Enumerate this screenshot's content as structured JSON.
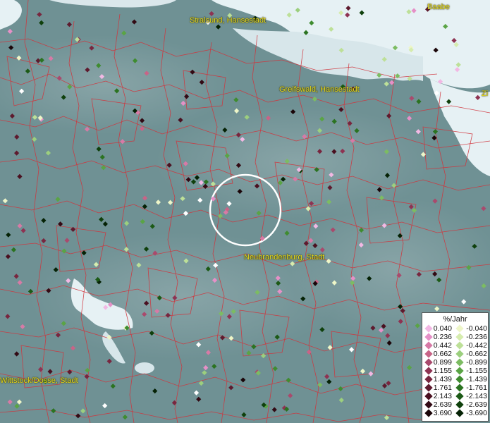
{
  "map": {
    "cities": [
      {
        "name": "Stralsund, Hansestadt"
      },
      {
        "name": "Greifswald, Hansestadt"
      },
      {
        "name": "Neubrandenburg, Stadt"
      },
      {
        "name": "Wittstock/Dosse, Stadt"
      },
      {
        "name": "Baabe"
      },
      {
        "name": "Zi"
      }
    ],
    "colors": {
      "land": "#6f9194",
      "water": "#e6f1f4",
      "boundary": "#d0343c",
      "label": "#e8dc1e",
      "circle": "#ffffff"
    }
  },
  "legend": {
    "title": "%/Jahr",
    "positive": [
      {
        "value": "0.040",
        "color": "#f2b8e4"
      },
      {
        "value": "0.236",
        "color": "#e690c7"
      },
      {
        "value": "0.442",
        "color": "#d77aa6"
      },
      {
        "value": "0.662",
        "color": "#c86487"
      },
      {
        "value": "0.899",
        "color": "#a94a6d"
      },
      {
        "value": "1.155",
        "color": "#8e3352"
      },
      {
        "value": "1.439",
        "color": "#78263f"
      },
      {
        "value": "1.761",
        "color": "#5e1a2e"
      },
      {
        "value": "2.143",
        "color": "#4a1020"
      },
      {
        "value": "2.639",
        "color": "#320a14"
      },
      {
        "value": "3.690",
        "color": "#1a0508"
      }
    ],
    "negative": [
      {
        "value": "-0.040",
        "color": "#eef6c8"
      },
      {
        "value": "-0.236",
        "color": "#d6ecae"
      },
      {
        "value": "-0.442",
        "color": "#bde098"
      },
      {
        "value": "-0.662",
        "color": "#9ccf7e"
      },
      {
        "value": "-0.899",
        "color": "#7cbc62"
      },
      {
        "value": "-1.155",
        "color": "#5aa445"
      },
      {
        "value": "-1.439",
        "color": "#3f8c30"
      },
      {
        "value": "-1.761",
        "color": "#2b7321"
      },
      {
        "value": "-2.143",
        "color": "#1c5a16"
      },
      {
        "value": "-2.639",
        "color": "#0f400c"
      },
      {
        "value": "-3.690",
        "color": "#052205"
      }
    ]
  }
}
